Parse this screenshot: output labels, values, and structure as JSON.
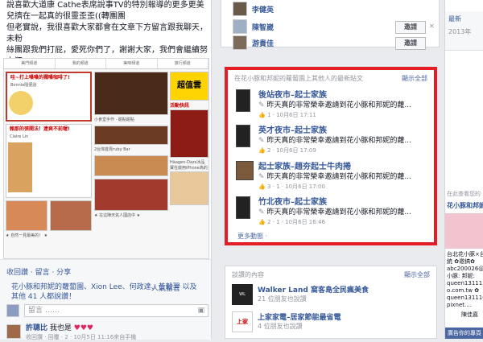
{
  "post": {
    "line1": "說喜歡大道康 Cathe表席說事TV的特別報導的更多更美",
    "line2": "兒擠在一起真的很靈歪歪((轉團團",
    "line3": "但老實說，我很喜歡大家都會在文章下方留言跟我聊天，未粉",
    "line4": "絲團跟我們打屁，愛死你們了，謝謝大家，我們會繼續努力狂",
    "line5": "吃的"
  },
  "magazine": {
    "nav": [
      "美門頻道",
      "我的頻道",
      "美味頻道",
      "旅行頻道"
    ],
    "promo_heading": "超值雲",
    "promo_sub": "活動快訊",
    "card1_title": "哇~打上嗓嗓的獨嗓咖啡了!",
    "card1_author": "Bonnie隨便說",
    "card2_title": "賴那的張開法！逮爽不前喔!",
    "card2_author": "Claire Lin",
    "card3_title": "小食堂手作 · 甜點甜點",
    "card4_title": "2台灣首見ruby Bar",
    "card5_title": "Häagen-Dazs冰品",
    "card6_title": "寶在啟用iPhone為的",
    "card7_title": "★ 自然一見最美的！ ★",
    "card8_title": "★ 在這陣天氣人國店中 ★"
  },
  "engage": {
    "actions": "收回讚 · 留言 · 分享",
    "likes": "花小豚和邦妮的蘿蔔園、Xion Lee、何政達、黃毅羿 以及其他 41 人都說讚！",
    "reply_placeholder": "留言 ……",
    "comment_author": "許聰比",
    "comment_text": "我也是",
    "comment_meta": "收回讚 · 回覆 · 2 · 10月5日 11:16來自手機",
    "top_comments": "人氣留言"
  },
  "friends": [
    {
      "name": "李健英"
    },
    {
      "name": "陳智崴",
      "button": "邀請"
    },
    {
      "name": "游貴佳",
      "button": "邀請"
    }
  ],
  "feed": {
    "header": "在花小豚和邦妮的蘿蔔園上其他人的最新貼文",
    "view_all": "顯示全部",
    "more": "更多動態 ·",
    "items": [
      {
        "title": "後站夜市–起士家族",
        "desc": "昨天真的非常榮幸邀請到花小豚和邦妮的蘿...",
        "meta": "1 · 10月6日 17:11"
      },
      {
        "title": "英才夜市–起士家族",
        "desc": "昨天真的非常榮幸邀請到花小豚和邦妮的蘿...",
        "meta": "2 · 10月6日 17:09"
      },
      {
        "title": "起士家族–趙夯起士牛肉捲",
        "desc": "昨天真的非常榮幸邀請到花小豚和邦妮的蘿...",
        "meta": "3 · 1 · 10月6日 17:00"
      },
      {
        "title": "竹北夜市–起士家族",
        "desc": "昨天真的非常榮幸邀請到花小豚和邦妮的蘿...",
        "meta": "2 · 1 · 10月6日 16:46"
      }
    ]
  },
  "discuss": {
    "header": "談讚的內容",
    "view_all": "顯示全部",
    "items": [
      {
        "title": "Walker Land 窩客島全民瘋美食",
        "meta": "21 位朋友也說讚"
      },
      {
        "title": "上家家電–居家節能最省電",
        "meta": "4 位朋友也說讚"
      }
    ]
  },
  "right": {
    "latest": "最新",
    "year": "2013年",
    "page_heading": "在此查看您的",
    "page_name": "花小豚和邦妮的",
    "snippet1": "台北花小豚×台",
    "snippet2": "統 ✿邀搞✿",
    "snippet3": "abc200026@y",
    "snippet4": "小豚: 邦妮:",
    "snippet5": "queen1311110",
    "snippet6": "o.com.tw ✿",
    "snippet7": "queen131110",
    "snippet8": "pixnet....",
    "ad_label": "廣告你的專頁",
    "right_btn": "陳佳嘉"
  }
}
